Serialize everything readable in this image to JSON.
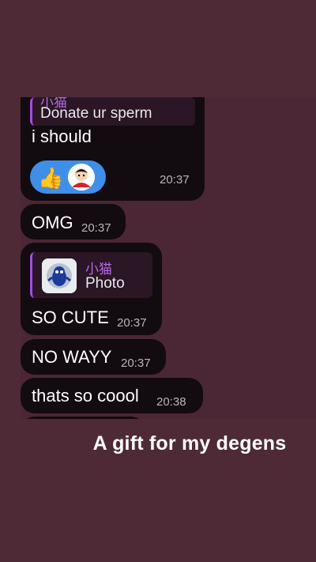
{
  "messages": {
    "first": {
      "reply_name": "小猫",
      "reply_text": "Donate ur sperm",
      "text": "i should",
      "time": "20:37",
      "reactions": [
        "thumbs-up-emoji",
        "red-character-sticker"
      ]
    },
    "omg": {
      "text": "OMG",
      "time": "20:37"
    },
    "cute": {
      "reply_name": "小猫",
      "reply_text": "Photo",
      "text": "SO CUTE",
      "time": "20:37"
    },
    "noway": {
      "text": "NO WAYY",
      "time": "20:37"
    },
    "cool": {
      "text": "thats so coool",
      "time": "20:38"
    }
  },
  "caption": "A gift for my degens",
  "colors": {
    "background": "#4e2a36",
    "bubble": "#120b10",
    "reply_accent": "#a64be6",
    "reaction": "#3f8fe8",
    "timestamp": "#b7b7b7"
  }
}
